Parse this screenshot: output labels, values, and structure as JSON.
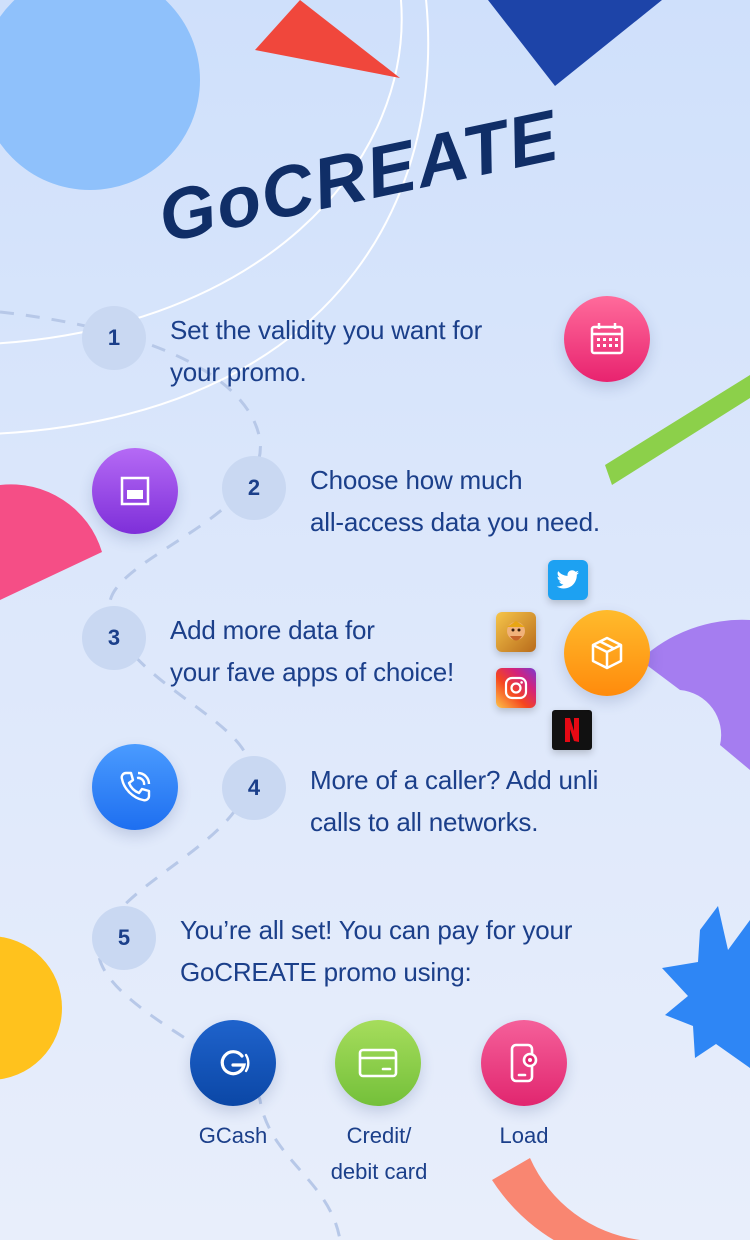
{
  "brand": {
    "title": "GoCREATE"
  },
  "colors": {
    "navy": "#1b3f8a",
    "pink": "#ee3d7d",
    "purple": "#8b3fe0",
    "orange": "#ff9d12",
    "blue": "#2a7bf0",
    "green": "#86cc44",
    "gcash_blue": "#0b4fb3"
  },
  "steps": [
    {
      "number": "1",
      "lines": [
        "Set the validity you want for",
        "your promo."
      ],
      "icon": "calendar-icon"
    },
    {
      "number": "2",
      "lines": [
        "Choose how much",
        "all-access data you need."
      ],
      "icon": "data-bar-icon"
    },
    {
      "number": "3",
      "lines": [
        "Add more data for",
        "your fave apps of choice!"
      ],
      "icon": "box-icon",
      "apps": [
        "twitter-icon",
        "clash-of-clans-icon",
        "instagram-icon",
        "netflix-icon"
      ]
    },
    {
      "number": "4",
      "lines": [
        "More of a caller? Add unli",
        "calls to all networks."
      ],
      "icon": "phone-call-icon"
    },
    {
      "number": "5",
      "lines": [
        "You’re all set! You can pay for your",
        "GoCREATE promo using:"
      ]
    }
  ],
  "payment_methods": [
    {
      "label_lines": [
        "GCash"
      ],
      "icon": "gcash-icon"
    },
    {
      "label_lines": [
        "Credit/",
        "debit card"
      ],
      "icon": "card-icon"
    },
    {
      "label_lines": [
        "Load"
      ],
      "icon": "load-phone-icon"
    }
  ]
}
